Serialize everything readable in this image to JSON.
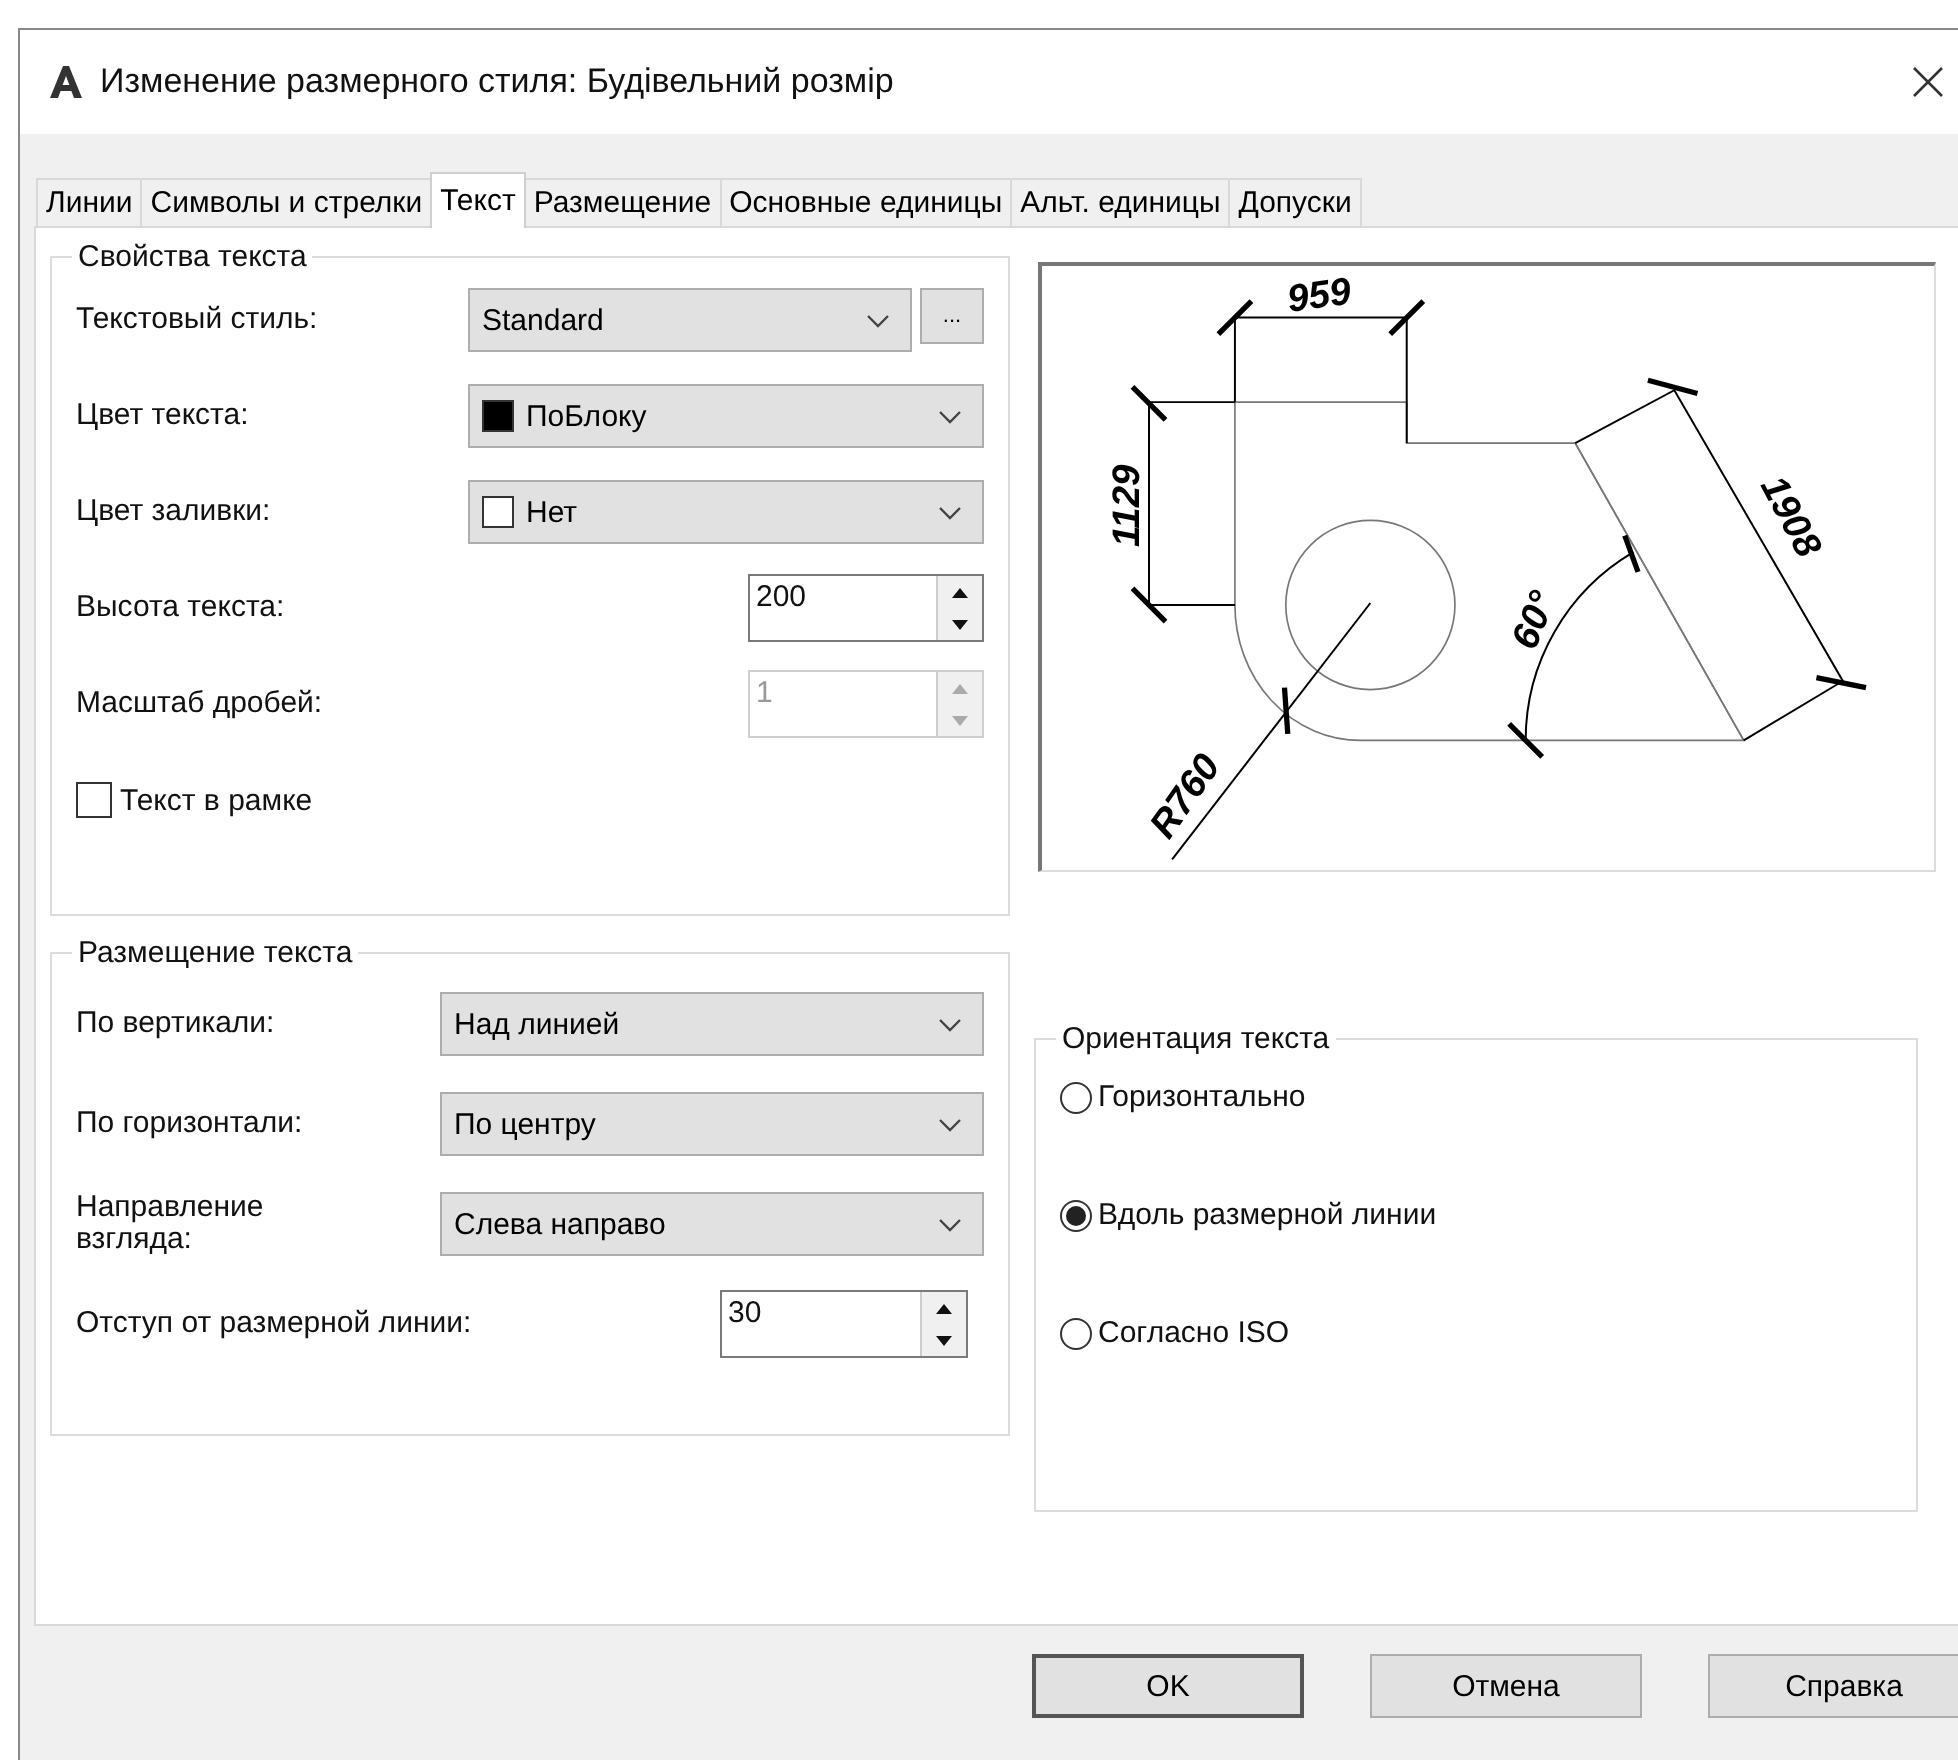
{
  "window": {
    "title": "Изменение размерного стиля: Будівельний розмір"
  },
  "tabs": [
    {
      "label": "Линии",
      "selected": false
    },
    {
      "label": "Символы и стрелки",
      "selected": false
    },
    {
      "label": "Текст",
      "selected": true
    },
    {
      "label": "Размещение",
      "selected": false
    },
    {
      "label": "Основные единицы",
      "selected": false
    },
    {
      "label": "Альт. единицы",
      "selected": false
    },
    {
      "label": "Допуски",
      "selected": false
    }
  ],
  "text_properties": {
    "title": "Свойства текста",
    "rows": [
      {
        "kind": "select",
        "label": "Текстовый стиль:",
        "value": "Standard",
        "more_button": "..."
      },
      {
        "kind": "select",
        "label": "Цвет текста:",
        "value": "ПоБлоку",
        "color": "#000000"
      },
      {
        "kind": "select",
        "label": "Цвет заливки:",
        "value": "Нет",
        "color": "#ffffff"
      },
      {
        "kind": "spinner",
        "label": "Высота текста:",
        "value": "200",
        "disabled": false
      },
      {
        "kind": "spinner",
        "label": "Масштаб дробей:",
        "value": "1",
        "disabled": true
      },
      {
        "kind": "checkbox",
        "label": "Текст в рамке",
        "checked": false
      }
    ]
  },
  "preview": {
    "labels": [
      "959",
      "1129",
      "1908",
      "60°",
      "R760"
    ]
  },
  "text_placement": {
    "title": "Размещение текста",
    "rows": [
      {
        "kind": "select",
        "label": "По вертикали:",
        "value": "Над линией"
      },
      {
        "kind": "select",
        "label": "По горизонтали:",
        "value": "По центру"
      },
      {
        "kind": "select",
        "label": "Направление взгляда:",
        "value": "Слева направо"
      },
      {
        "kind": "spinner",
        "label": "Отступ от размерной линии:",
        "value": "30",
        "disabled": false
      }
    ]
  },
  "text_orientation": {
    "title": "Ориентация текста",
    "options": [
      {
        "label": "Горизонтально",
        "selected": false
      },
      {
        "label": "Вдоль размерной линии",
        "selected": true
      },
      {
        "label": "Согласно ISO",
        "selected": false
      }
    ]
  },
  "buttons": [
    {
      "label": "OK",
      "default": true
    },
    {
      "label": "Отмена",
      "default": false
    },
    {
      "label": "Справка",
      "default": false
    }
  ]
}
